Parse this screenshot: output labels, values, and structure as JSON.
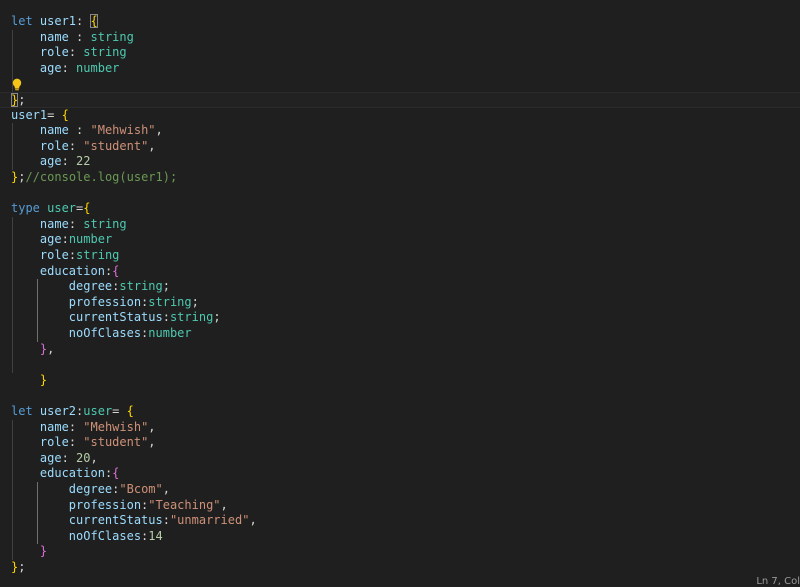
{
  "editor": {
    "language": "typescript",
    "colors": {
      "background": "#1f1f1f",
      "keyword": "#569cd6",
      "variable": "#9cdcfe",
      "type": "#4ec9b0",
      "string": "#ce9178",
      "number": "#b5cea8",
      "punctuation": "#d4d4d4",
      "bracket_level_1": "#ffd700",
      "bracket_level_2": "#da70d6",
      "comment": "#6a9955"
    },
    "lightbulb_icon": "lightbulb-icon",
    "lines": [
      [
        [
          "kw",
          "let "
        ],
        [
          "var",
          "user1"
        ],
        [
          "p",
          ": "
        ],
        [
          "b1m",
          "{"
        ]
      ],
      [
        [
          "p",
          "    "
        ],
        [
          "var",
          "name"
        ],
        [
          "p",
          " : "
        ],
        [
          "type",
          "string"
        ]
      ],
      [
        [
          "p",
          "    "
        ],
        [
          "var",
          "role"
        ],
        [
          "p",
          ": "
        ],
        [
          "type",
          "string"
        ]
      ],
      [
        [
          "p",
          "    "
        ],
        [
          "var",
          "age"
        ],
        [
          "p",
          ": "
        ],
        [
          "type",
          "number"
        ]
      ],
      [],
      [
        [
          "b1m",
          "}"
        ],
        [
          "p",
          ";"
        ]
      ],
      [
        [
          "var",
          "user1"
        ],
        [
          "p",
          "= "
        ],
        [
          "b1",
          "{"
        ]
      ],
      [
        [
          "p",
          "    "
        ],
        [
          "var",
          "name"
        ],
        [
          "p",
          " : "
        ],
        [
          "str",
          "\"Mehwish\""
        ],
        [
          "p",
          ","
        ]
      ],
      [
        [
          "p",
          "    "
        ],
        [
          "var",
          "role"
        ],
        [
          "p",
          ": "
        ],
        [
          "str",
          "\"student\""
        ],
        [
          "p",
          ","
        ]
      ],
      [
        [
          "p",
          "    "
        ],
        [
          "var",
          "age"
        ],
        [
          "p",
          ": "
        ],
        [
          "num",
          "22"
        ]
      ],
      [
        [
          "b1",
          "}"
        ],
        [
          "p",
          ";"
        ],
        [
          "cmt",
          "//console.log(user1);"
        ]
      ],
      [],
      [
        [
          "kw",
          "type "
        ],
        [
          "type",
          "user"
        ],
        [
          "p",
          "="
        ],
        [
          "b1",
          "{"
        ]
      ],
      [
        [
          "p",
          "    "
        ],
        [
          "var",
          "name"
        ],
        [
          "p",
          ": "
        ],
        [
          "type",
          "string"
        ]
      ],
      [
        [
          "p",
          "    "
        ],
        [
          "var",
          "age"
        ],
        [
          "p",
          ":"
        ],
        [
          "type",
          "number"
        ]
      ],
      [
        [
          "p",
          "    "
        ],
        [
          "var",
          "role"
        ],
        [
          "p",
          ":"
        ],
        [
          "type",
          "string"
        ]
      ],
      [
        [
          "p",
          "    "
        ],
        [
          "var",
          "education"
        ],
        [
          "p",
          ":"
        ],
        [
          "b2",
          "{"
        ]
      ],
      [
        [
          "p",
          "        "
        ],
        [
          "var",
          "degree"
        ],
        [
          "p",
          ":"
        ],
        [
          "type",
          "string"
        ],
        [
          "p",
          ";"
        ]
      ],
      [
        [
          "p",
          "        "
        ],
        [
          "var",
          "profession"
        ],
        [
          "p",
          ":"
        ],
        [
          "type",
          "string"
        ],
        [
          "p",
          ";"
        ]
      ],
      [
        [
          "p",
          "        "
        ],
        [
          "var",
          "currentStatus"
        ],
        [
          "p",
          ":"
        ],
        [
          "type",
          "string"
        ],
        [
          "p",
          ";"
        ]
      ],
      [
        [
          "p",
          "        "
        ],
        [
          "var",
          "noOfClases"
        ],
        [
          "p",
          ":"
        ],
        [
          "type",
          "number"
        ]
      ],
      [
        [
          "p",
          "    "
        ],
        [
          "b2",
          "}"
        ],
        [
          "p",
          ","
        ]
      ],
      [],
      [
        [
          "p",
          "    "
        ],
        [
          "b1",
          "}"
        ]
      ],
      [],
      [
        [
          "kw",
          "let "
        ],
        [
          "var",
          "user2"
        ],
        [
          "p",
          ":"
        ],
        [
          "type",
          "user"
        ],
        [
          "p",
          "= "
        ],
        [
          "b1",
          "{"
        ]
      ],
      [
        [
          "p",
          "    "
        ],
        [
          "var",
          "name"
        ],
        [
          "p",
          ": "
        ],
        [
          "str",
          "\"Mehwish\""
        ],
        [
          "p",
          ","
        ]
      ],
      [
        [
          "p",
          "    "
        ],
        [
          "var",
          "role"
        ],
        [
          "p",
          ": "
        ],
        [
          "str",
          "\"student\""
        ],
        [
          "p",
          ","
        ]
      ],
      [
        [
          "p",
          "    "
        ],
        [
          "var",
          "age"
        ],
        [
          "p",
          ": "
        ],
        [
          "num",
          "20"
        ],
        [
          "p",
          ","
        ]
      ],
      [
        [
          "p",
          "    "
        ],
        [
          "var",
          "education"
        ],
        [
          "p",
          ":"
        ],
        [
          "b2",
          "{"
        ]
      ],
      [
        [
          "p",
          "        "
        ],
        [
          "var",
          "degree"
        ],
        [
          "p",
          ":"
        ],
        [
          "str",
          "\"Bcom\""
        ],
        [
          "p",
          ","
        ]
      ],
      [
        [
          "p",
          "        "
        ],
        [
          "var",
          "profession"
        ],
        [
          "p",
          ":"
        ],
        [
          "str",
          "\"Teaching\""
        ],
        [
          "p",
          ","
        ]
      ],
      [
        [
          "p",
          "        "
        ],
        [
          "var",
          "currentStatus"
        ],
        [
          "p",
          ":"
        ],
        [
          "str",
          "\"unmarried\""
        ],
        [
          "p",
          ","
        ]
      ],
      [
        [
          "p",
          "        "
        ],
        [
          "var",
          "noOfClases"
        ],
        [
          "p",
          ":"
        ],
        [
          "num",
          "14"
        ]
      ],
      [
        [
          "p",
          "    "
        ],
        [
          "b2",
          "}"
        ]
      ],
      [
        [
          "b1",
          "}"
        ],
        [
          "p",
          ";"
        ]
      ]
    ]
  },
  "status_bar": {
    "cursor_position": "Ln 7, Col"
  }
}
